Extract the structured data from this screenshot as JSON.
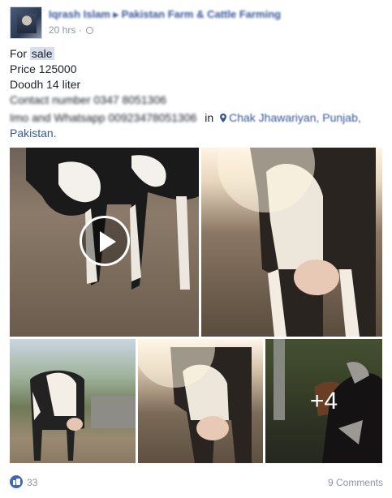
{
  "post": {
    "author_line": "Iqrash Islam ▸ Pakistan Farm & Cattle Farming",
    "time": "20 hrs",
    "separator": "·",
    "text": {
      "for": "For ",
      "sale": "sale",
      "price": "Price 125000",
      "doodh": "Doodh 14 liter",
      "contact": "Contact number 0347 8051306",
      "whatsapp": "Imo and Whatsapp 00923478051306",
      "in": "in",
      "location": "Chak Jhawariyan, Punjab,",
      "country": "Pakistan."
    }
  },
  "photos": {
    "more_label": "+4"
  },
  "footer": {
    "likes": "33",
    "comments": "9 Comments"
  },
  "colors": {
    "link": "#365899",
    "meta": "#90949c",
    "like": "#4267b2"
  }
}
